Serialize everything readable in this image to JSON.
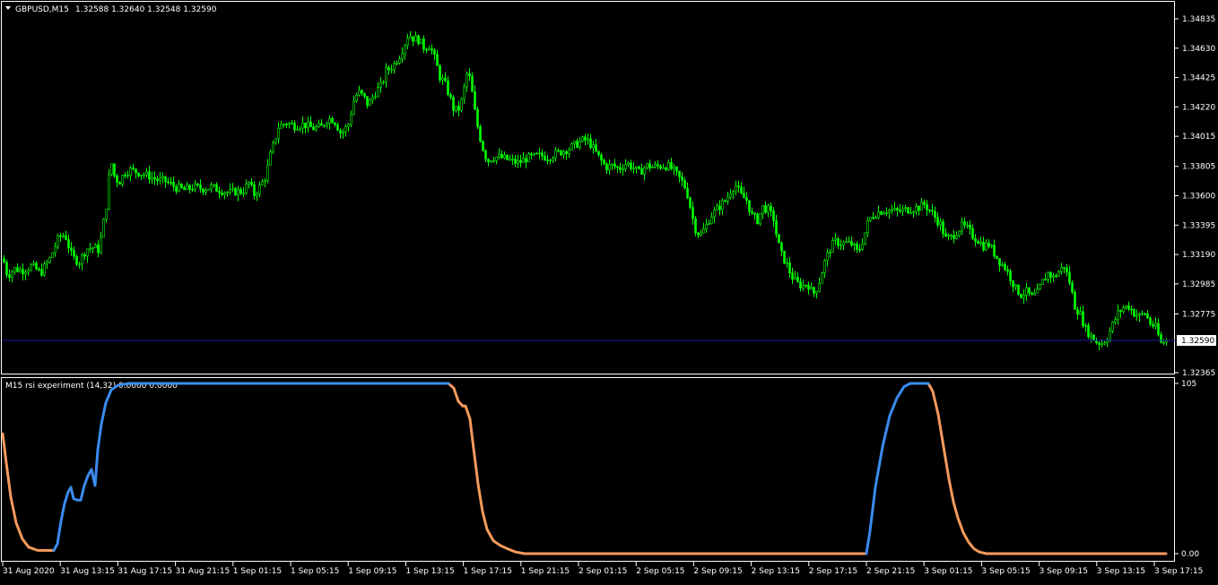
{
  "header": {
    "symbol": "GBPUSD,M15",
    "quote": "1.32588 1.32640 1.32548 1.32590"
  },
  "indicator": {
    "label": "M15 rsi experiment (14,32) 0.0000 0.0000"
  },
  "colors": {
    "background": "#000000",
    "candle": "#00ff00",
    "grid_frame": "#ffffff",
    "bid_line": "#1a1aa6",
    "price_tag_bg": "#ffffff",
    "price_tag_text": "#000000",
    "rsi_up": "#3b8bee",
    "rsi_down": "#f49a5c"
  },
  "chart_data": [
    {
      "type": "candlestick",
      "title": "GBPUSD,M15",
      "ylim": [
        1.32365,
        1.34835
      ],
      "y_ticks": [
        "1.34835",
        "1.34630",
        "1.34425",
        "1.34220",
        "1.34015",
        "1.33805",
        "1.33600",
        "1.33395",
        "1.33190",
        "1.32985",
        "1.32775",
        "1.32365"
      ],
      "current_price": "1.32590",
      "x_ticks": [
        "31 Aug 2020",
        "31 Aug 13:15",
        "31 Aug 17:15",
        "31 Aug 21:15",
        "1 Sep 01:15",
        "1 Sep 05:15",
        "1 Sep 09:15",
        "1 Sep 13:15",
        "1 Sep 17:15",
        "1 Sep 21:15",
        "2 Sep 01:15",
        "2 Sep 05:15",
        "2 Sep 09:15",
        "2 Sep 13:15",
        "2 Sep 17:15",
        "2 Sep 21:15",
        "3 Sep 01:15",
        "3 Sep 05:15",
        "3 Sep 09:15",
        "3 Sep 13:15",
        "3 Sep 17:15"
      ],
      "close_path": [
        [
          0,
          1.3335
        ],
        [
          3,
          1.3316
        ],
        [
          8,
          1.3304
        ],
        [
          15,
          1.3309
        ],
        [
          25,
          1.3308
        ],
        [
          35,
          1.3311
        ],
        [
          45,
          1.3306
        ],
        [
          55,
          1.3316
        ],
        [
          65,
          1.3331
        ],
        [
          72,
          1.3333
        ],
        [
          80,
          1.3317
        ],
        [
          88,
          1.3314
        ],
        [
          96,
          1.3323
        ],
        [
          104,
          1.3324
        ],
        [
          110,
          1.3322
        ],
        [
          113,
          1.3334
        ],
        [
          118,
          1.3353
        ],
        [
          123,
          1.3386
        ],
        [
          126,
          1.3375
        ],
        [
          132,
          1.3369
        ],
        [
          138,
          1.3376
        ],
        [
          145,
          1.3378
        ],
        [
          155,
          1.3376
        ],
        [
          165,
          1.3374
        ],
        [
          175,
          1.3371
        ],
        [
          185,
          1.337
        ],
        [
          195,
          1.3366
        ],
        [
          205,
          1.3364
        ],
        [
          215,
          1.3366
        ],
        [
          225,
          1.3365
        ],
        [
          235,
          1.3366
        ],
        [
          245,
          1.3364
        ],
        [
          255,
          1.3362
        ],
        [
          262,
          1.3363
        ],
        [
          270,
          1.3363
        ],
        [
          277,
          1.3369
        ],
        [
          283,
          1.3361
        ],
        [
          290,
          1.3367
        ],
        [
          296,
          1.3374
        ],
        [
          300,
          1.3386
        ],
        [
          305,
          1.3397
        ],
        [
          310,
          1.3408
        ],
        [
          318,
          1.3411
        ],
        [
          328,
          1.3409
        ],
        [
          338,
          1.341
        ],
        [
          348,
          1.3407
        ],
        [
          358,
          1.3408
        ],
        [
          365,
          1.3414
        ],
        [
          372,
          1.3413
        ],
        [
          380,
          1.3403
        ],
        [
          388,
          1.341
        ],
        [
          395,
          1.3429
        ],
        [
          400,
          1.3432
        ],
        [
          405,
          1.3429
        ],
        [
          410,
          1.3423
        ],
        [
          415,
          1.3429
        ],
        [
          420,
          1.3434
        ],
        [
          425,
          1.3437
        ],
        [
          430,
          1.3447
        ],
        [
          438,
          1.3451
        ],
        [
          445,
          1.3458
        ],
        [
          450,
          1.3465
        ],
        [
          455,
          1.3473
        ],
        [
          460,
          1.347
        ],
        [
          466,
          1.3469
        ],
        [
          473,
          1.3463
        ],
        [
          478,
          1.3465
        ],
        [
          482,
          1.346
        ],
        [
          486,
          1.3452
        ],
        [
          490,
          1.3443
        ],
        [
          495,
          1.3439
        ],
        [
          500,
          1.3431
        ],
        [
          505,
          1.3421
        ],
        [
          510,
          1.3419
        ],
        [
          515,
          1.3428
        ],
        [
          520,
          1.3445
        ],
        [
          524,
          1.3441
        ],
        [
          528,
          1.3422
        ],
        [
          533,
          1.3405
        ],
        [
          538,
          1.3393
        ],
        [
          543,
          1.3384
        ],
        [
          548,
          1.3387
        ],
        [
          555,
          1.3387
        ],
        [
          562,
          1.3386
        ],
        [
          570,
          1.3384
        ],
        [
          578,
          1.3383
        ],
        [
          586,
          1.3386
        ],
        [
          594,
          1.3387
        ],
        [
          602,
          1.3388
        ],
        [
          610,
          1.3387
        ],
        [
          618,
          1.3389
        ],
        [
          626,
          1.3391
        ],
        [
          634,
          1.3393
        ],
        [
          642,
          1.3396
        ],
        [
          650,
          1.3399
        ],
        [
          656,
          1.3398
        ],
        [
          662,
          1.3392
        ],
        [
          668,
          1.3386
        ],
        [
          675,
          1.338
        ],
        [
          682,
          1.3381
        ],
        [
          690,
          1.3379
        ],
        [
          698,
          1.3383
        ],
        [
          705,
          1.338
        ],
        [
          712,
          1.3376
        ],
        [
          720,
          1.3381
        ],
        [
          728,
          1.338
        ],
        [
          736,
          1.3381
        ],
        [
          744,
          1.3381
        ],
        [
          750,
          1.3378
        ],
        [
          756,
          1.3373
        ],
        [
          762,
          1.3368
        ],
        [
          766,
          1.3361
        ],
        [
          770,
          1.335
        ],
        [
          774,
          1.3338
        ],
        [
          780,
          1.3332
        ],
        [
          786,
          1.3338
        ],
        [
          792,
          1.3346
        ],
        [
          798,
          1.335
        ],
        [
          804,
          1.3354
        ],
        [
          810,
          1.3358
        ],
        [
          815,
          1.3365
        ],
        [
          820,
          1.3367
        ],
        [
          826,
          1.336
        ],
        [
          832,
          1.3357
        ],
        [
          838,
          1.3346
        ],
        [
          844,
          1.3343
        ],
        [
          850,
          1.3352
        ],
        [
          856,
          1.335
        ],
        [
          862,
          1.3344
        ],
        [
          866,
          1.333
        ],
        [
          870,
          1.332
        ],
        [
          876,
          1.3313
        ],
        [
          882,
          1.3304
        ],
        [
          888,
          1.3299
        ],
        [
          894,
          1.3297
        ],
        [
          900,
          1.3299
        ],
        [
          906,
          1.3291
        ],
        [
          912,
          1.3298
        ],
        [
          918,
          1.3312
        ],
        [
          924,
          1.3322
        ],
        [
          930,
          1.3328
        ],
        [
          936,
          1.3327
        ],
        [
          942,
          1.3327
        ],
        [
          950,
          1.3326
        ],
        [
          956,
          1.332
        ],
        [
          962,
          1.333
        ],
        [
          968,
          1.3343
        ],
        [
          974,
          1.3347
        ],
        [
          980,
          1.3349
        ],
        [
          986,
          1.335
        ],
        [
          992,
          1.335
        ],
        [
          1000,
          1.3349
        ],
        [
          1008,
          1.335
        ],
        [
          1016,
          1.3351
        ],
        [
          1024,
          1.3352
        ],
        [
          1030,
          1.3354
        ],
        [
          1036,
          1.335
        ],
        [
          1042,
          1.3345
        ],
        [
          1048,
          1.334
        ],
        [
          1054,
          1.333
        ],
        [
          1060,
          1.3331
        ],
        [
          1066,
          1.3335
        ],
        [
          1072,
          1.3339
        ],
        [
          1078,
          1.3337
        ],
        [
          1084,
          1.3332
        ],
        [
          1090,
          1.3329
        ],
        [
          1096,
          1.3325
        ],
        [
          1102,
          1.3326
        ],
        [
          1108,
          1.332
        ],
        [
          1114,
          1.3314
        ],
        [
          1120,
          1.331
        ],
        [
          1126,
          1.3303
        ],
        [
          1132,
          1.3295
        ],
        [
          1138,
          1.3291
        ],
        [
          1144,
          1.3293
        ],
        [
          1150,
          1.3289
        ],
        [
          1156,
          1.3292
        ],
        [
          1162,
          1.33
        ],
        [
          1168,
          1.3306
        ],
        [
          1174,
          1.3303
        ],
        [
          1180,
          1.3307
        ],
        [
          1186,
          1.3311
        ],
        [
          1192,
          1.33
        ],
        [
          1198,
          1.3283
        ],
        [
          1204,
          1.3277
        ],
        [
          1210,
          1.3267
        ],
        [
          1216,
          1.3262
        ],
        [
          1222,
          1.3258
        ],
        [
          1228,
          1.3257
        ],
        [
          1234,
          1.3261
        ],
        [
          1240,
          1.327
        ],
        [
          1246,
          1.3278
        ],
        [
          1252,
          1.3282
        ],
        [
          1258,
          1.3283
        ],
        [
          1264,
          1.3278
        ],
        [
          1270,
          1.3276
        ],
        [
          1276,
          1.3278
        ],
        [
          1282,
          1.3271
        ],
        [
          1288,
          1.3268
        ],
        [
          1294,
          1.3257
        ],
        [
          1300,
          1.3259
        ]
      ]
    },
    {
      "type": "line",
      "title": "M15 rsi experiment (14,32) 0.0000 0.0000",
      "ylim": [
        0,
        105
      ],
      "y_ticks": [
        "105",
        "0.00"
      ],
      "series": [
        {
          "color": "#f49a5c",
          "segments": [
            [
              [
                3,
                74
              ],
              [
                7,
                56
              ],
              [
                12,
                35
              ],
              [
                18,
                19
              ],
              [
                25,
                9
              ],
              [
                32,
                4
              ],
              [
                42,
                2
              ],
              [
                55,
                2
              ],
              [
                60,
                2
              ]
            ],
            [
              [
                500,
                105
              ],
              [
                506,
                102
              ],
              [
                511,
                94
              ],
              [
                516,
                91
              ],
              [
                519,
                91
              ]
            ],
            [
              [
                519,
                91
              ],
              [
                524,
                83
              ],
              [
                528,
                65
              ],
              [
                533,
                43
              ],
              [
                538,
                26
              ],
              [
                543,
                15
              ],
              [
                550,
                8
              ],
              [
                558,
                5
              ],
              [
                566,
                3
              ],
              [
                575,
                1
              ],
              [
                585,
                0
              ],
              [
                700,
                0
              ],
              [
                800,
                0
              ],
              [
                900,
                0
              ],
              [
                966,
                0
              ]
            ],
            [
              [
                1035,
                105
              ],
              [
                1040,
                100
              ],
              [
                1046,
                86
              ],
              [
                1052,
                66
              ],
              [
                1058,
                46
              ],
              [
                1063,
                32
              ],
              [
                1068,
                22
              ],
              [
                1074,
                13
              ],
              [
                1080,
                7
              ],
              [
                1086,
                3
              ],
              [
                1092,
                1
              ],
              [
                1100,
                0
              ],
              [
                1200,
                0
              ],
              [
                1300,
                0
              ]
            ]
          ]
        },
        {
          "color": "#3b8bee",
          "segments": [
            [
              [
                60,
                2
              ],
              [
                64,
                6
              ],
              [
                68,
                20
              ],
              [
                72,
                31
              ],
              [
                76,
                38
              ],
              [
                79,
                41
              ],
              [
                82,
                34
              ],
              [
                86,
                33
              ],
              [
                90,
                33
              ],
              [
                94,
                42
              ],
              [
                98,
                48
              ],
              [
                102,
                52
              ],
              [
                106,
                42
              ],
              [
                109,
                64
              ],
              [
                113,
                80
              ],
              [
                118,
                93
              ],
              [
                124,
                101
              ],
              [
                132,
                104
              ],
              [
                145,
                105
              ],
              [
                200,
                105
              ],
              [
                300,
                105
              ],
              [
                400,
                105
              ],
              [
                500,
                105
              ]
            ],
            [
              [
                966,
                0
              ],
              [
                970,
                14
              ],
              [
                976,
                41
              ],
              [
                984,
                66
              ],
              [
                992,
                85
              ],
              [
                1000,
                96
              ],
              [
                1008,
                103
              ],
              [
                1015,
                105
              ],
              [
                1025,
                105
              ],
              [
                1035,
                105
              ]
            ]
          ]
        }
      ]
    }
  ]
}
